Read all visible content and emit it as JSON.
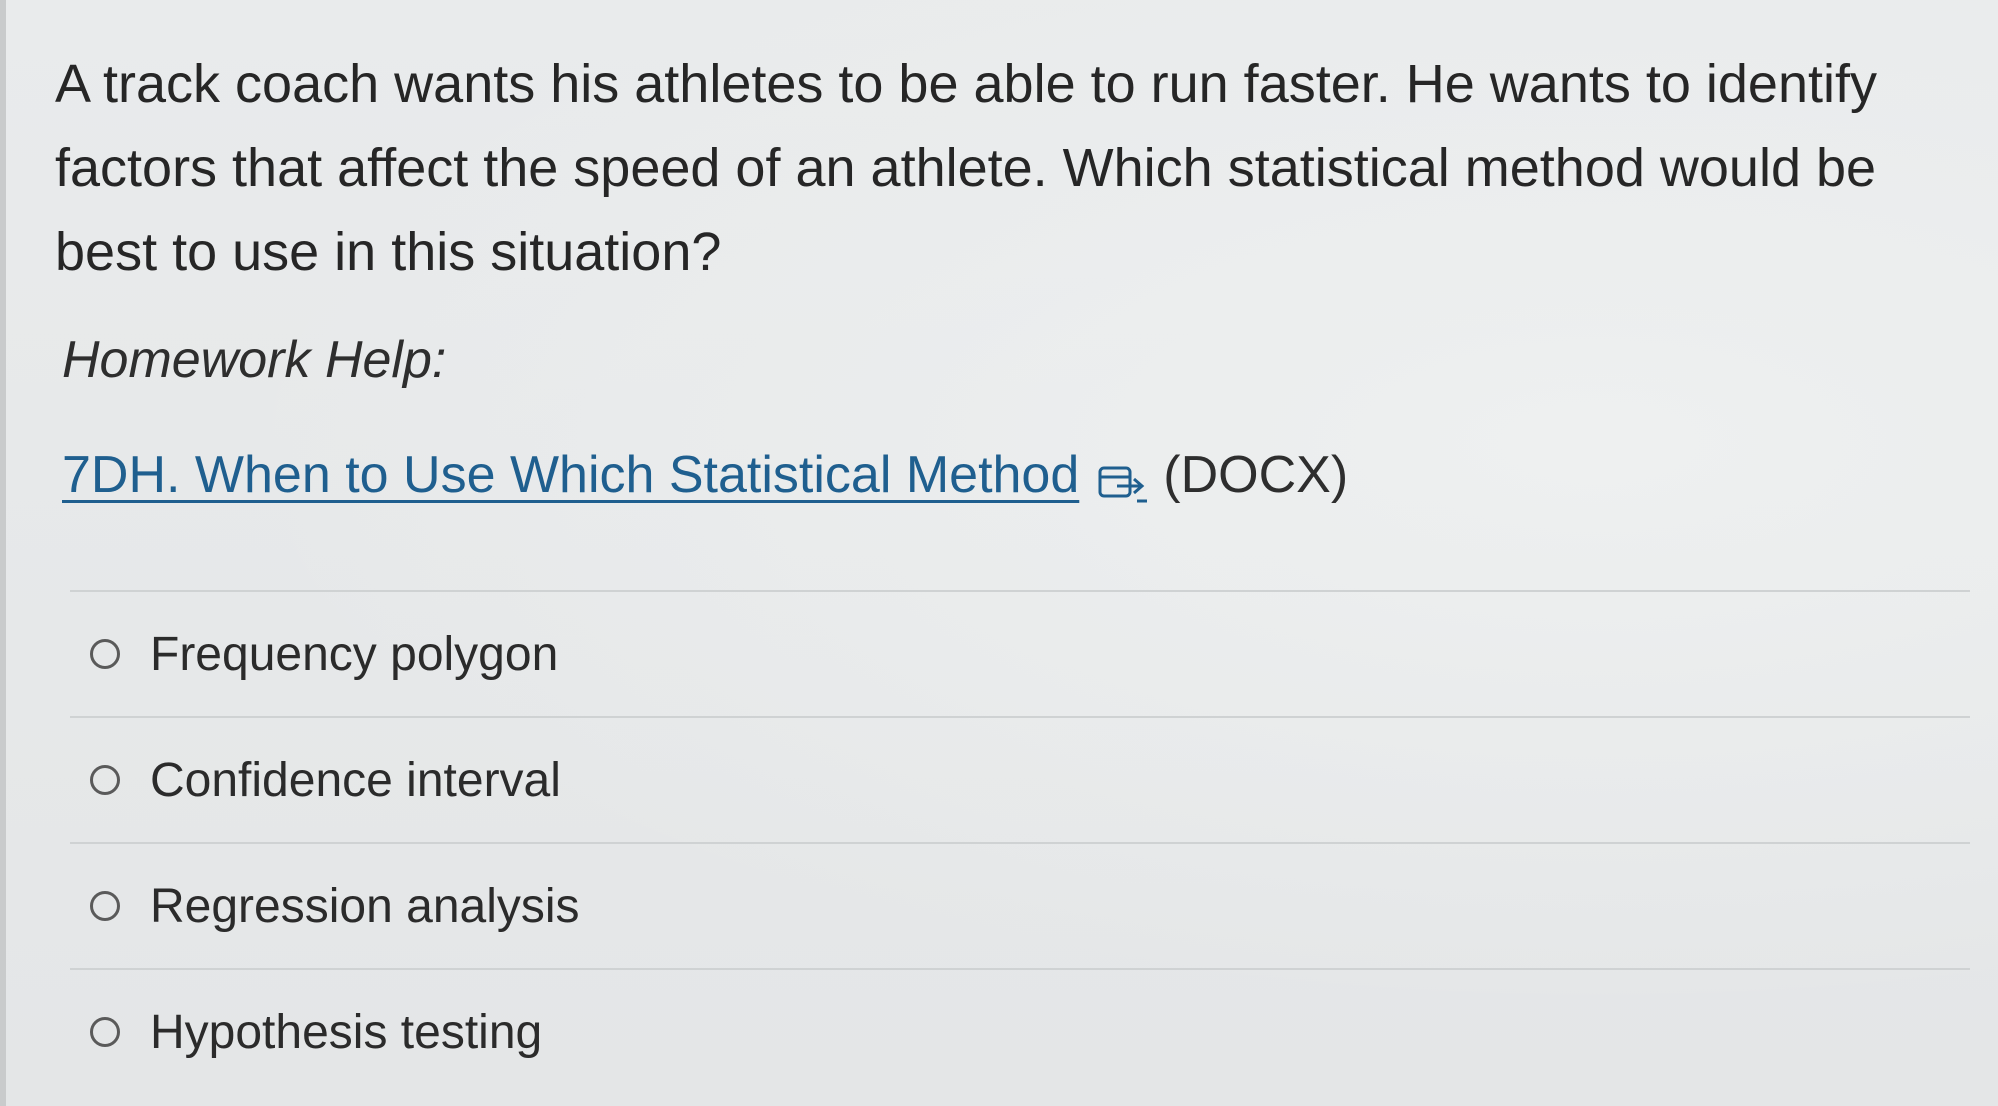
{
  "question": {
    "text": "A track coach wants his athletes to be able to run faster.  He wants to identify factors that affect the speed of an athlete.  Which statistical method would be best to use in this situation?"
  },
  "homework_help": {
    "label": "Homework Help:",
    "link_text": "7DH. When to Use Which Statistical Method",
    "link_icon": "external-link-icon",
    "file_type": "(DOCX)"
  },
  "options": [
    {
      "label": "Frequency polygon",
      "selected": false
    },
    {
      "label": "Confidence interval",
      "selected": false
    },
    {
      "label": "Regression analysis",
      "selected": false
    },
    {
      "label": "Hypothesis testing",
      "selected": false
    }
  ],
  "colors": {
    "background": "#e7e9ea",
    "text": "#262626",
    "link": "#1f5f8f",
    "divider": "#cfd2d3"
  }
}
